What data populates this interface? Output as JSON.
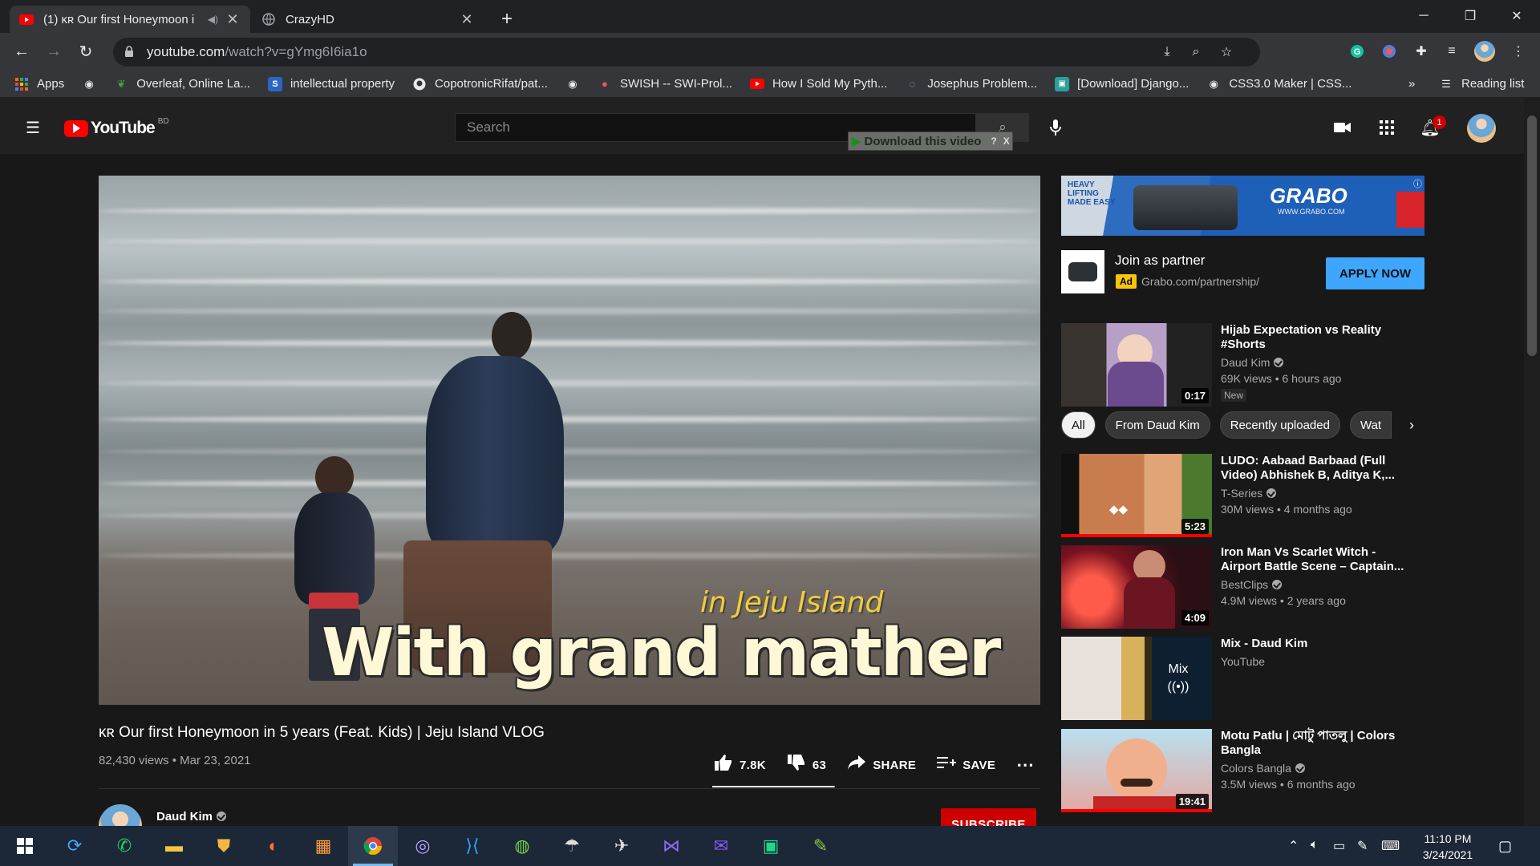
{
  "browser": {
    "tabs": [
      {
        "title": "(1) ᴋʀ Our first Honeymoon i",
        "active": true
      },
      {
        "title": "CrazyHD",
        "active": false
      }
    ],
    "new_tab_symbol": "+",
    "url_domain": "youtube.com",
    "url_path": "/watch?v=gYmg6I6ia1o",
    "bookmarks": [
      {
        "label": "Apps",
        "icon": "apps-grid-icon"
      },
      {
        "label": "",
        "icon": "globe-icon"
      },
      {
        "label": "Overleaf, Online La...",
        "icon": "overleaf-leaf-icon"
      },
      {
        "label": "intellectual property",
        "icon": "s-square-icon"
      },
      {
        "label": "CopotronicRifat/pat...",
        "icon": "github-icon"
      },
      {
        "label": "",
        "icon": "globe-icon"
      },
      {
        "label": "SWISH -- SWI-Prol...",
        "icon": "swish-icon"
      },
      {
        "label": "How I Sold My Pyth...",
        "icon": "youtube-icon"
      },
      {
        "label": "Josephus Problem...",
        "icon": "loading-icon"
      },
      {
        "label": "[Download] Django...",
        "icon": "download-site-icon"
      },
      {
        "label": "CSS3.0 Maker | CSS...",
        "icon": "globe-icon"
      }
    ],
    "bookmarks_more": "»",
    "reading_list": "Reading list"
  },
  "youtube": {
    "logo_text": "YouTube",
    "region": "BD",
    "search_placeholder": "Search",
    "download_label": "Download this video",
    "download_help": "?",
    "download_close": "X",
    "notification_count": "1",
    "video": {
      "caption_main": "With grand mather",
      "caption_sub": "in Jeju Island",
      "title": "ᴋʀ Our first Honeymoon in 5 years (Feat. Kids) | Jeju Island VLOG",
      "meta": "82,430 views • Mar 23, 2021",
      "likes": "7.8K",
      "dislikes": "63",
      "share": "SHARE",
      "save": "SAVE",
      "like_ratio": 0.992
    },
    "channel": {
      "name": "Daud Kim",
      "subscribe": "SUBSCRIBE"
    },
    "ad": {
      "banner_tagline": "HEAVY LIFTING MADE EASY",
      "banner_brand": "GRABO",
      "banner_url": "WWW.GRABO.COM",
      "title": "Join as partner",
      "badge": "Ad",
      "url": "Grabo.com/partnership/",
      "cta": "APPLY NOW"
    },
    "chips": [
      "All",
      "From Daud Kim",
      "Recently uploaded",
      "Wat"
    ],
    "recommended_top": {
      "title": "Hijab Expectation vs Reality #Shorts",
      "channel": "Daud Kim",
      "views": "69K views • 6 hours ago",
      "badge": "New",
      "duration": "0:17"
    },
    "recommended": [
      {
        "title": "LUDO: Aabaad Barbaad (Full Video) Abhishek B, Aditya K,...",
        "channel": "T-Series",
        "views": "30M views • 4 months ago",
        "duration": "5:23",
        "watched": 1.0
      },
      {
        "title": "Iron Man Vs Scarlet Witch - Airport Battle Scene – Captain...",
        "channel": "BestClips",
        "views": "4.9M views • 2 years ago",
        "duration": "4:09",
        "watched": 0
      },
      {
        "title": "Mix - Daud Kim",
        "channel": "YouTube",
        "views": "",
        "duration": "",
        "watched": 0,
        "mix_label": "Mix"
      },
      {
        "title": "Motu Patlu | মোটু পাতলু | Colors Bangla",
        "channel": "Colors Bangla",
        "views": "3.5M views • 6 months ago",
        "duration": "19:41",
        "watched": 1.0
      }
    ]
  },
  "taskbar": {
    "time": "11:10 PM",
    "date": "3/24/2021"
  },
  "colors": {
    "accent_red": "#ff0000",
    "subscribe_red": "#cc0000",
    "apply_blue": "#3ea6ff",
    "yt_bg": "#181818",
    "chrome_toolbar": "#35363a"
  }
}
